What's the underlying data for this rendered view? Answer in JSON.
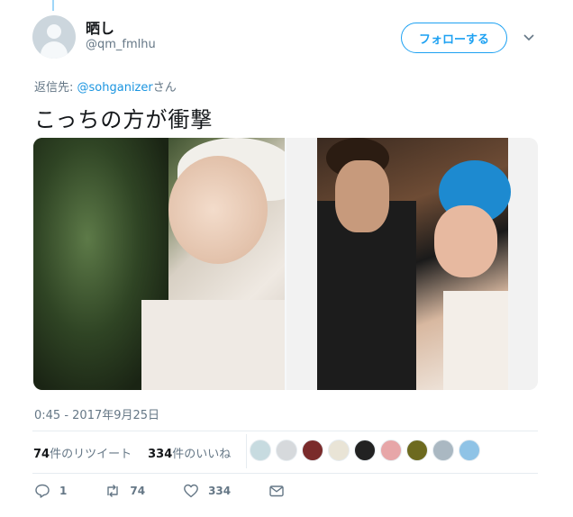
{
  "tweet": {
    "display_name": "晒し",
    "handle": "@qm_fmlhu",
    "follow_label": "フォローする",
    "reply_prefix": "返信先: ",
    "reply_mention": "@sohganizer",
    "reply_suffix": "さん",
    "text": "こっちの方が衝撃",
    "timestamp": "0:45 - 2017年9月25日"
  },
  "stats": {
    "retweets_count": "74",
    "retweets_label": "件のリツイート",
    "likes_count": "334",
    "likes_label": "件のいいね"
  },
  "likers": [
    {
      "name": "liker-avatar-1",
      "color": "#c7dbe0"
    },
    {
      "name": "liker-avatar-2",
      "color": "#d6d9dc"
    },
    {
      "name": "liker-avatar-3",
      "color": "#7a2b2b"
    },
    {
      "name": "liker-avatar-4",
      "color": "#e9e4d6"
    },
    {
      "name": "liker-avatar-5",
      "color": "#222222"
    },
    {
      "name": "liker-avatar-6",
      "color": "#e7a6a8"
    },
    {
      "name": "liker-avatar-7",
      "color": "#6d6a1f"
    },
    {
      "name": "liker-avatar-8",
      "color": "#aab8c2"
    },
    {
      "name": "liker-avatar-9",
      "color": "#8fc3e6"
    }
  ],
  "actions": {
    "reply_count": "1",
    "retweet_count": "74",
    "like_count": "334"
  },
  "colors": {
    "accent": "#1da1f2",
    "muted": "#657786"
  }
}
